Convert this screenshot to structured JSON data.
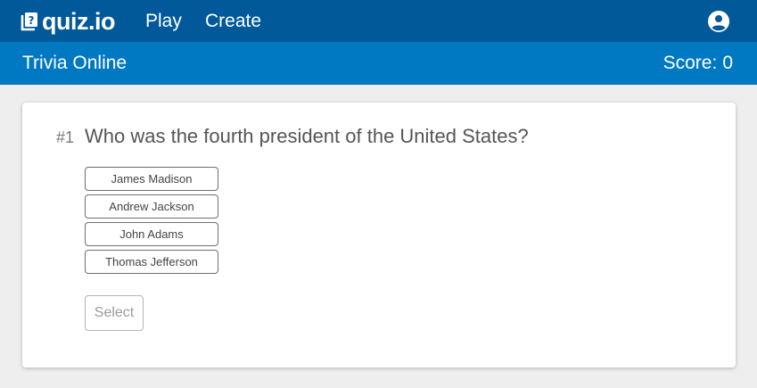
{
  "topbar": {
    "brand": "quiz.io",
    "logo_icon": "question-book-icon",
    "nav": [
      {
        "label": "Play"
      },
      {
        "label": "Create"
      }
    ],
    "account_icon": "account-circle-icon"
  },
  "subbar": {
    "title": "Trivia Online",
    "score_label": "Score:",
    "score_value": "0"
  },
  "question": {
    "number": "#1",
    "text": "Who was the fourth president of the United States?",
    "options": [
      {
        "label": "James Madison"
      },
      {
        "label": "Andrew Jackson"
      },
      {
        "label": "John Adams"
      },
      {
        "label": "Thomas Jefferson"
      }
    ],
    "select_label": "Select",
    "select_disabled": true
  },
  "colors": {
    "topbar": "#01599a",
    "subbar": "#0179c2",
    "background": "#eeeeee"
  }
}
